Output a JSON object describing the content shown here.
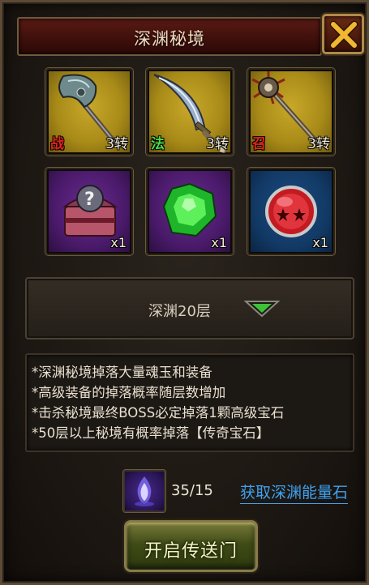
{
  "header": {
    "title": "深渊秘境"
  },
  "equipment": [
    {
      "tag": "战",
      "tag_color": "#e0251a",
      "rank": "3转",
      "icon": "battle-axe-icon"
    },
    {
      "tag": "法",
      "tag_color": "#4fd84a",
      "rank": "3转",
      "icon": "curved-blade-icon"
    },
    {
      "tag": "召",
      "tag_color": "#e0251a",
      "rank": "3转",
      "icon": "spiked-mace-icon"
    }
  ],
  "rewards": [
    {
      "qty": "x1",
      "icon": "mystery-chest-icon"
    },
    {
      "qty": "x1",
      "icon": "green-gem-icon"
    },
    {
      "qty": "x1",
      "icon": "red-orb-icon"
    }
  ],
  "floor_select": {
    "label": "深渊20层"
  },
  "description": [
    "*深渊秘境掉落大量魂玉和装备",
    "*高级装备的掉落概率随层数增加",
    "*击杀秘境最终BOSS必定掉落1颗高级宝石",
    "*50层以上秘境有概率掉落【传奇宝石】"
  ],
  "energy_stone": {
    "count": "35/15",
    "link_label": "获取深渊能量石"
  },
  "open_button": {
    "label": "开启传送门"
  }
}
